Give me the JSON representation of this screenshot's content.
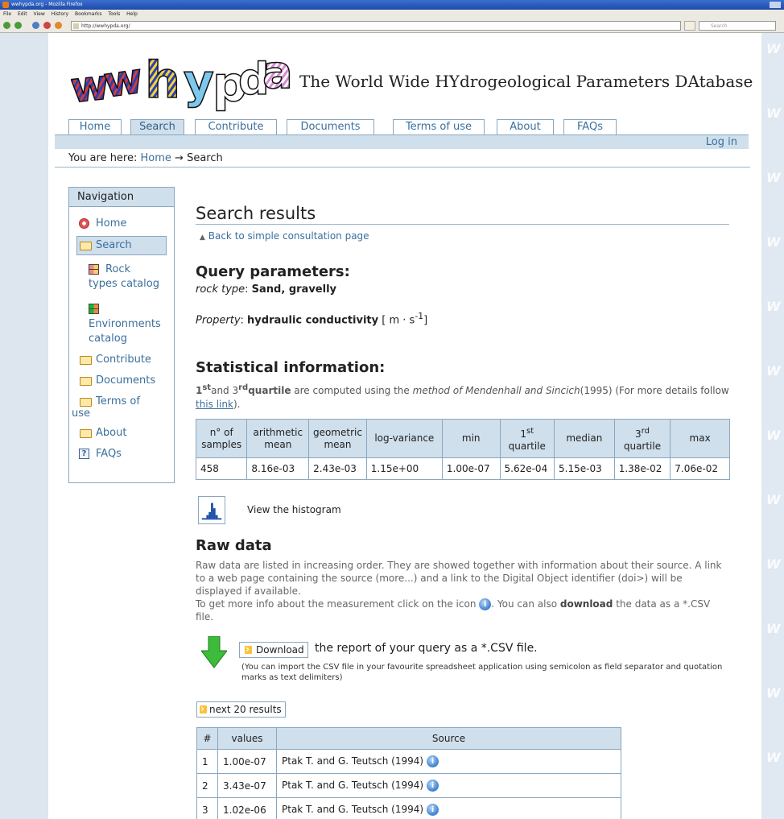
{
  "browser": {
    "window_title": "wwhypda.org - Mozilla Firefox",
    "menu": [
      "File",
      "Edit",
      "View",
      "History",
      "Bookmarks",
      "Tools",
      "Help"
    ],
    "url": "http://wwhypda.org/",
    "search_placeholder": "Search"
  },
  "header": {
    "site_title": "The World Wide HYdrogeological Parameters DAtabase"
  },
  "tabs": [
    {
      "label": "Home"
    },
    {
      "label": "Search"
    },
    {
      "label": "Contribute"
    },
    {
      "label": "Documents"
    },
    {
      "label": "Terms of use"
    },
    {
      "label": "About"
    },
    {
      "label": "FAQs"
    }
  ],
  "login_label": "Log in",
  "breadcrumb": {
    "prefix": "You are here:",
    "home": "Home",
    "separator": "→",
    "current": "Search"
  },
  "navigation": {
    "title": "Navigation",
    "items": {
      "home": "Home",
      "search": "Search",
      "rock_types_1": "Rock",
      "rock_types_2": "types catalog",
      "env_1": "Environments",
      "env_2": "catalog",
      "contribute": "Contribute",
      "documents": "Documents",
      "terms_1": "Terms of",
      "terms_2": "use",
      "about": "About",
      "faqs": "FAQs"
    }
  },
  "main": {
    "title": "Search results",
    "back_link": "Back to simple consultation page",
    "query_title": "Query parameters:",
    "rock_type_label": "rock type",
    "rock_type_value": "Sand, gravelly",
    "property_label": "Property",
    "property_value": "hydraulic conductivity",
    "unit_text": "[ m · s",
    "unit_exp": "-1",
    "unit_close": "]",
    "stats_title": "Statistical information:",
    "stats_note_1": "1",
    "stats_note_st": "st",
    "stats_note_and": "and 3",
    "stats_note_rd": "rd",
    "stats_note_quartile": "quartile",
    "stats_note_mid": " are computed using the ",
    "stats_note_method": "method of Mendenhall and Sincich",
    "stats_note_after": "(1995) (For more details follow ",
    "stats_note_link": "this link",
    "stats_note_end": ")."
  },
  "stats_table": {
    "headers": {
      "samples": "n° of samples",
      "arith": "arithmetic mean",
      "geom": "geometric mean",
      "logvar": "log-variance",
      "min": "min",
      "q1_num": "1",
      "q1_sup": "st",
      "q1_word": "quartile",
      "median": "median",
      "q3_num": "3",
      "q3_sup": "rd",
      "q3_word": "quartile",
      "max": "max"
    },
    "row": {
      "samples": "458",
      "arith": "8.16e-03",
      "geom": "2.43e-03",
      "logvar": "1.15e+00",
      "min": "1.00e-07",
      "q1": "5.62e-04",
      "median": "5.15e-03",
      "q3": "1.38e-02",
      "max": "7.06e-02"
    }
  },
  "histogram_label": "View the histogram",
  "raw": {
    "title": "Raw data",
    "text_1": "Raw data are listed in increasing order. They are showed together with information about their source. A link to a web page containing the source (more...) and a link to the Digital Object identifier (doi>) will be displayed if available.",
    "text_2a": "To get more info about the measurement click on the icon ",
    "text_2b": ". You can also ",
    "text_2_bold": "download",
    "text_2c": " the data as a *.CSV file.",
    "download_label": "Download",
    "download_text": "the report of your query as a *.CSV file.",
    "download_note": "(You can import the CSV file in your favourite spreadsheet application using semicolon as field separator and quotation marks as text delimiters)",
    "next_label": "next 20 results"
  },
  "raw_table": {
    "headers": {
      "num": "#",
      "values": "values",
      "source": "Source"
    },
    "rows": [
      {
        "num": "1",
        "value": "1.00e-07",
        "source": "Ptak T. and G. Teutsch (1994)"
      },
      {
        "num": "2",
        "value": "3.43e-07",
        "source": "Ptak T. and G. Teutsch (1994)"
      },
      {
        "num": "3",
        "value": "1.02e-06",
        "source": "Ptak T. and G. Teutsch (1994)"
      }
    ]
  },
  "icons": {
    "info": "info-icon",
    "folder": "folder-icon",
    "download_arrow": "green-down-arrow-icon",
    "histogram": "histogram-icon"
  },
  "colors": {
    "accent": "#3b6f9c",
    "tab_bg": "#cfdfec",
    "border": "#8aa7bf"
  }
}
